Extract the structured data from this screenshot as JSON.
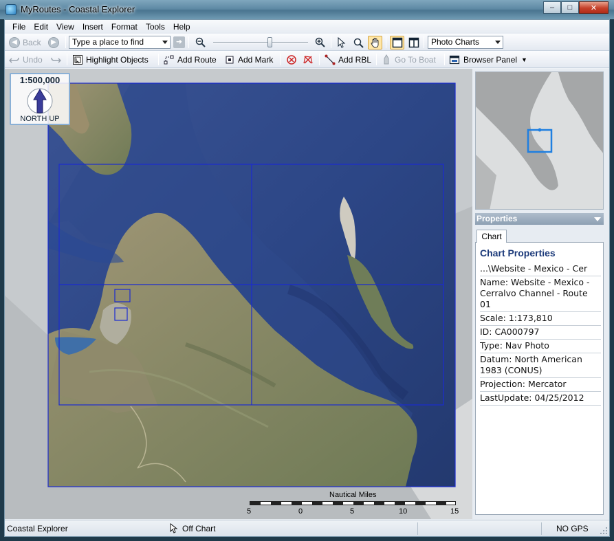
{
  "window": {
    "title": "MyRoutes - Coastal Explorer",
    "buttons": {
      "minimize": "–",
      "maximize": "□",
      "close": "✕"
    }
  },
  "menu": [
    "File",
    "Edit",
    "View",
    "Insert",
    "Format",
    "Tools",
    "Help"
  ],
  "toolbar1": {
    "back": "Back",
    "search_placeholder": "Type a place to find",
    "go_icon": "arrow-right-icon",
    "zoom_level": 0.6,
    "chart_type": "Photo Charts"
  },
  "toolbar2": {
    "undo": "Undo",
    "highlight_objects": "Highlight Objects",
    "add_route": "Add Route",
    "add_mark": "Add Mark",
    "add_rbl": "Add RBL",
    "go_to_boat": "Go To Boat",
    "browser_panel": "Browser Panel"
  },
  "map": {
    "scale": "1:500,000",
    "orientation": "NORTH UP",
    "scale_bar": {
      "title": "Nautical Miles",
      "labels": [
        "5",
        "0",
        "5",
        "10",
        "15"
      ]
    }
  },
  "properties": {
    "header": "Properties",
    "tab": "Chart",
    "title": "Chart Properties",
    "rows": [
      "...\\Website - Mexico - Cer",
      "Name: Website - Mexico - Cerralvo Channel - Route 01",
      "Scale: 1:173,810",
      "ID: CA000797",
      "Type: Nav Photo",
      "Datum: North American 1983 (CONUS)",
      "Projection: Mercator",
      "LastUpdate: 04/25/2012"
    ]
  },
  "status": {
    "app": "Coastal Explorer",
    "position": "Off Chart",
    "gps": "NO GPS"
  },
  "colors": {
    "grid": "#1b2bd0",
    "sea": "#2c4a8c",
    "land": "#8a8a66"
  }
}
